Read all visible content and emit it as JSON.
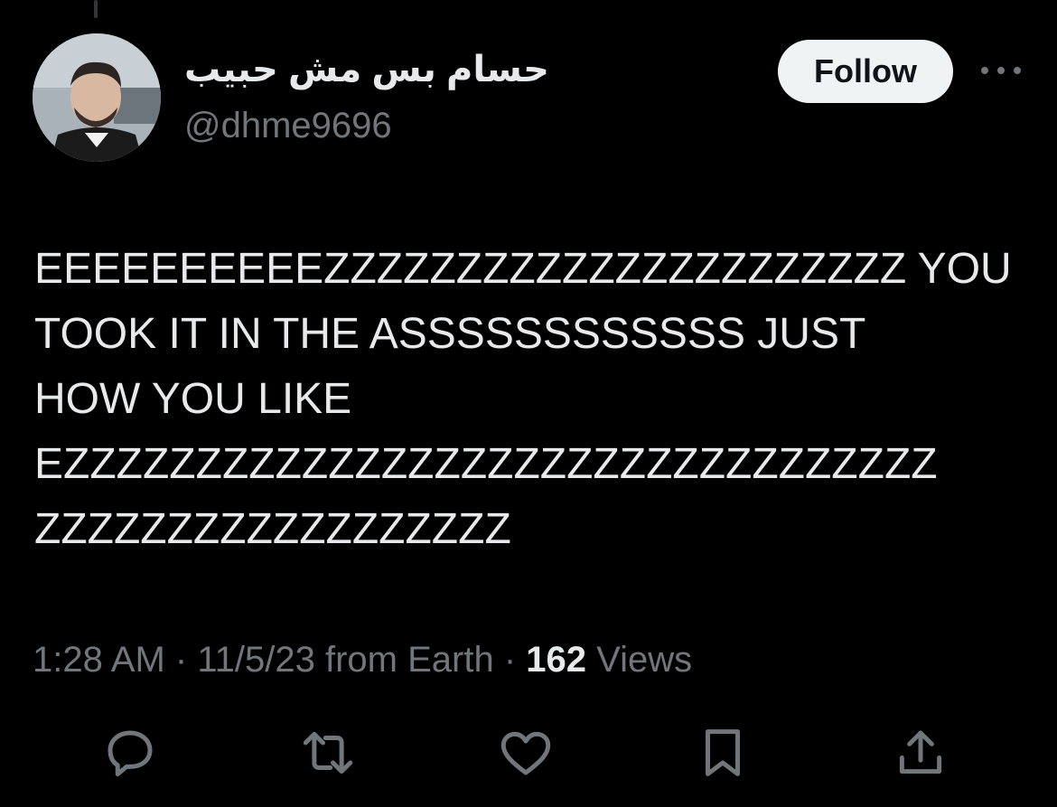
{
  "tweet": {
    "author": {
      "display_name": "حسام بس مش حبيب",
      "handle": "@dhme9696"
    },
    "follow_label": "Follow",
    "more_icon": "more-horizontal-icon",
    "text_lines": [
      "EEEEEEEEEEZZZZZZZZZZZZZZZZZZZZZZ YOU",
      "TOOK IT IN THE ASSSSSSSSSSSS JUST",
      "HOW YOU LIKE",
      "EZZZZZZZZZZZZZZZZZZZZZZZZZZZZZZZZZ",
      "ZZZZZZZZZZZZZZZZZZ"
    ],
    "meta": {
      "time": "1:28 AM",
      "separator": "·",
      "date": "11/5/23",
      "location": "from Earth",
      "views_count": "162",
      "views_label": "Views"
    },
    "actions": [
      {
        "name": "reply",
        "icon": "reply-icon"
      },
      {
        "name": "retweet",
        "icon": "retweet-icon"
      },
      {
        "name": "like",
        "icon": "heart-icon"
      },
      {
        "name": "bookmark",
        "icon": "bookmark-icon"
      },
      {
        "name": "share",
        "icon": "share-icon"
      }
    ]
  },
  "colors": {
    "background": "#000000",
    "primary_text": "#e7e9ea",
    "secondary_text": "#71767b",
    "follow_button_bg": "#eff3f4",
    "follow_button_text": "#0f1419"
  }
}
